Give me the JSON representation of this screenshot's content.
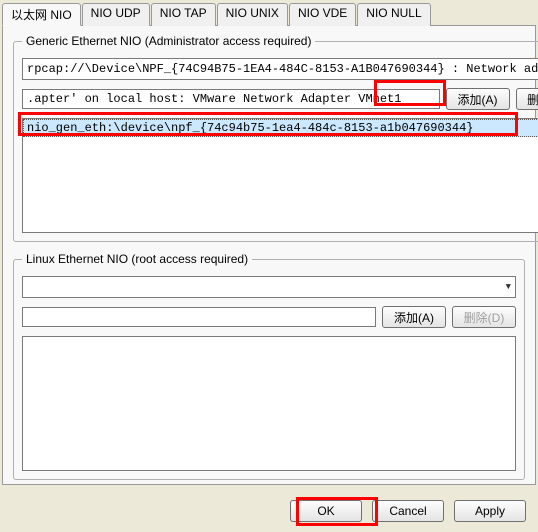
{
  "tabs": {
    "t0": "以太网 NIO",
    "t1": "NIO UDP",
    "t2": "NIO TAP",
    "t3": "NIO UNIX",
    "t4": "NIO VDE",
    "t5": "NIO NULL"
  },
  "generic": {
    "legend": "Generic Ethernet NIO (Administrator access required)",
    "combo_value": "rpcap://\\Device\\NPF_{74C94B75-1EA4-484C-8153-A1B047690344} : Network adapte",
    "txt_value": ".apter' on local host: VMware Network Adapter VMnet1",
    "add_label": "添加(A)",
    "del_label": "删除(D)",
    "list_item0": "nio_gen_eth:\\device\\npf_{74c94b75-1ea4-484c-8153-a1b047690344}"
  },
  "linux": {
    "legend": "Linux Ethernet NIO (root access required)",
    "combo_value": "",
    "txt_value": "",
    "add_label": "添加(A)",
    "del_label": "删除(D)"
  },
  "buttons": {
    "ok": "OK",
    "cancel": "Cancel",
    "apply": "Apply"
  }
}
